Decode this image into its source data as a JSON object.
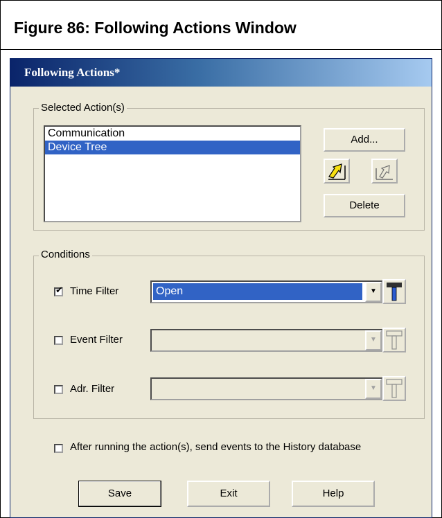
{
  "figure": {
    "title": "Figure 86:  Following Actions Window"
  },
  "window": {
    "title": "Following Actions*"
  },
  "selected_actions": {
    "legend": "Selected Action(s)",
    "items": [
      "Communication",
      "Device Tree"
    ],
    "selected_index": 1,
    "add_label": "Add...",
    "delete_label": "Delete",
    "move_icon": "arrow-into-icon",
    "remove_icon": "arrow-out-icon"
  },
  "conditions": {
    "legend": "Conditions",
    "rows": [
      {
        "label": "Time Filter",
        "checked": true,
        "value": "Open",
        "enabled": true,
        "tool_icon": "hammer-icon"
      },
      {
        "label": "Event Filter",
        "checked": false,
        "value": "",
        "enabled": false,
        "tool_icon": "hammer-icon"
      },
      {
        "label": "Adr. Filter",
        "checked": false,
        "value": "",
        "enabled": false,
        "tool_icon": "hammer-icon"
      }
    ]
  },
  "history": {
    "label": "After running the action(s), send events to the History database",
    "checked": false
  },
  "buttons": {
    "save": "Save",
    "exit": "Exit",
    "help": "Help"
  },
  "colors": {
    "title_bar": "#0a246a",
    "selection": "#3163c5",
    "dialog_bg": "#ece9d8"
  }
}
